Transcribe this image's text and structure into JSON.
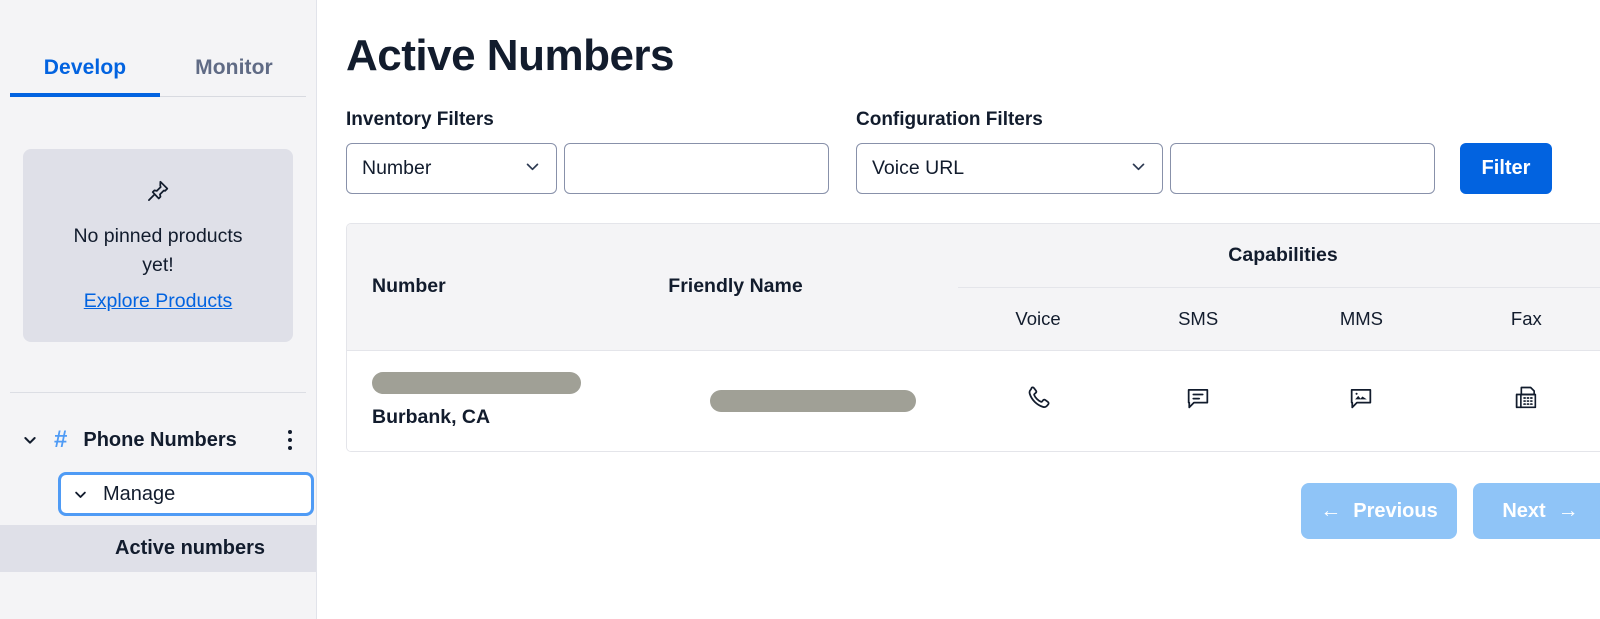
{
  "sidebar": {
    "tabs": [
      {
        "label": "Develop",
        "active": true
      },
      {
        "label": "Monitor",
        "active": false
      }
    ],
    "pinned_card": {
      "icon": "pin-icon",
      "empty_text": "No pinned products yet!",
      "link_label": "Explore Products"
    },
    "nav": {
      "group": {
        "label": "Phone Numbers",
        "expand_icon": "chevron-down-icon",
        "product_icon": "hash-icon",
        "overflow_icon": "kebab-menu-icon"
      },
      "submenu": {
        "label": "Manage",
        "expand_icon": "chevron-down-icon",
        "focused": true
      },
      "child_items": [
        {
          "label": "Active numbers",
          "selected": true
        }
      ]
    }
  },
  "main": {
    "page_title": "Active Numbers",
    "filters": {
      "inventory": {
        "label": "Inventory Filters",
        "select_value": "Number",
        "select_icon": "chevron-down-icon",
        "input_value": "",
        "input_placeholder": ""
      },
      "configuration": {
        "label": "Configuration Filters",
        "select_value": "Voice URL",
        "select_icon": "chevron-down-icon",
        "input_value": "",
        "input_placeholder": ""
      },
      "submit_label": "Filter"
    },
    "table": {
      "headers": {
        "number": "Number",
        "friendly_name": "Friendly Name",
        "capabilities": "Capabilities",
        "capability_columns": [
          "Voice",
          "SMS",
          "MMS",
          "Fax"
        ]
      },
      "rows": [
        {
          "number_redacted": true,
          "location": "Burbank, CA",
          "friendly_name_redacted": true,
          "capabilities": {
            "voice": "phone-icon",
            "sms": "chat-bubble-icon",
            "mms": "chat-bubble-image-icon",
            "fax": "fax-machine-icon"
          }
        }
      ]
    },
    "pagination": {
      "previous_label": "Previous",
      "previous_arrow": "←",
      "previous_disabled": true,
      "next_label": "Next",
      "next_arrow": "→",
      "next_disabled": true
    }
  },
  "colors": {
    "accent_blue": "#0263e0",
    "focus_blue": "#4f9bf5",
    "disabled_blue": "#8fc4f7",
    "text_dark": "#121c2d",
    "sidebar_bg": "#f4f4f6",
    "card_bg": "#dfe0e8",
    "redact_gray": "#a0a096",
    "border_gray": "#e4e5ea"
  }
}
